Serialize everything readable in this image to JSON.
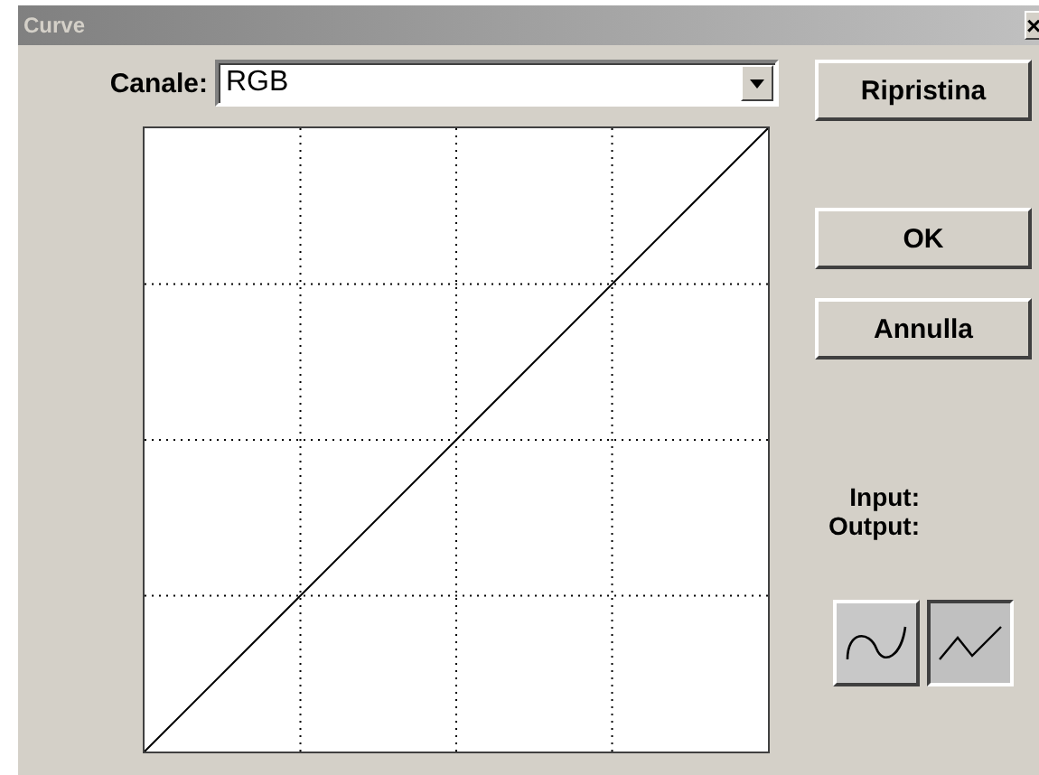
{
  "window": {
    "title": "Curve",
    "close": "×"
  },
  "channel": {
    "label": "Canale:",
    "value": "RGB"
  },
  "buttons": [
    {
      "label": "Ripristina"
    },
    {
      "label": "OK"
    },
    {
      "label": "Annulla"
    }
  ],
  "readouts": [
    {
      "label": "Input:"
    },
    {
      "label": "Output:"
    }
  ],
  "modes": [
    {
      "kind": "smooth",
      "selected": false
    },
    {
      "kind": "polyline",
      "selected": true
    }
  ]
}
